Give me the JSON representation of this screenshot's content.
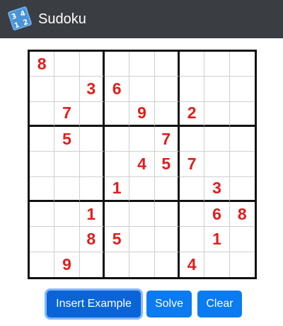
{
  "window": {
    "title": "Sudoku",
    "icon": "sudoku-app-icon",
    "icon_digits": [
      "3",
      "4",
      "1",
      "2"
    ]
  },
  "board": {
    "cells": [
      [
        "8",
        "",
        "",
        "",
        "",
        "",
        "",
        "",
        ""
      ],
      [
        "",
        "",
        "3",
        "6",
        "",
        "",
        "",
        "",
        ""
      ],
      [
        "",
        "7",
        "",
        "",
        "9",
        "",
        "2",
        "",
        ""
      ],
      [
        "",
        "5",
        "",
        "",
        "",
        "7",
        "",
        "",
        ""
      ],
      [
        "",
        "",
        "",
        "",
        "4",
        "5",
        "7",
        "",
        ""
      ],
      [
        "",
        "",
        "",
        "1",
        "",
        "",
        "",
        "3",
        ""
      ],
      [
        "",
        "",
        "1",
        "",
        "",
        "",
        "",
        "6",
        "8"
      ],
      [
        "",
        "",
        "8",
        "5",
        "",
        "",
        "",
        "1",
        ""
      ],
      [
        "",
        "9",
        "",
        "",
        "",
        "",
        "4",
        "",
        ""
      ]
    ],
    "digit_color": "#e31c1c"
  },
  "buttons": {
    "insert_example": "Insert Example",
    "solve": "Solve",
    "clear": "Clear",
    "color": "#0a7bf0"
  }
}
